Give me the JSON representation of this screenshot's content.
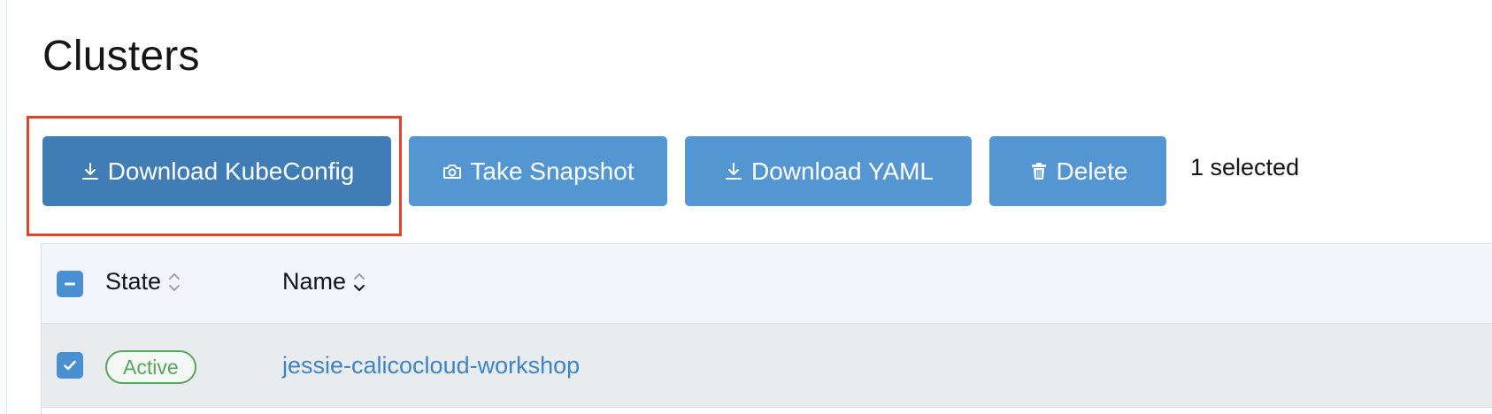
{
  "page": {
    "title": "Clusters"
  },
  "toolbar": {
    "download_kubeconfig_label": "Download KubeConfig",
    "take_snapshot_label": "Take Snapshot",
    "download_yaml_label": "Download YAML",
    "delete_label": "Delete",
    "selected_count": "1 selected"
  },
  "table": {
    "columns": [
      "State",
      "Name"
    ],
    "rows": [
      {
        "state": "Active",
        "name": "jessie-calicocloud-workshop",
        "selected": true
      }
    ],
    "header_checkbox": "indeterminate"
  },
  "colors": {
    "primary_button": "#3f7db4",
    "button": "#5496d2",
    "highlight": "#e0452a",
    "active_badge": "#58a55c",
    "link": "#3e84c6"
  },
  "icons": {
    "download": "download-icon",
    "snapshot": "camera-icon",
    "delete": "trash-icon",
    "sort": "sort-icon"
  }
}
